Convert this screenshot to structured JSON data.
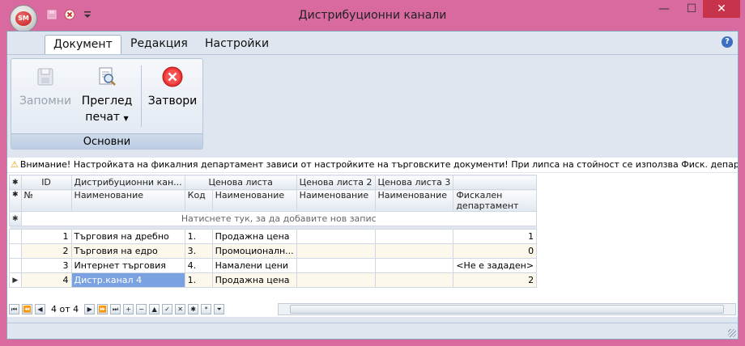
{
  "window": {
    "title": "Дистрибуционни канали",
    "app_badge": "SM",
    "minimize_glyph": "—",
    "maximize_glyph": "☐",
    "close_glyph": "✕"
  },
  "ribbon_tabs": [
    {
      "label": "Документ",
      "active": true
    },
    {
      "label": "Редакция",
      "active": false
    },
    {
      "label": "Настройки",
      "active": false
    }
  ],
  "ribbon": {
    "group_label": "Основни",
    "save_label": "Запомни",
    "preview_label_line1": "Преглед",
    "preview_label_line2": "печат",
    "close_label": "Затвори"
  },
  "warning_text": "Внимание! Настройката на фикалния департамент зависи от настройките на търговските документи! При липса на стойност се използва Фиск. департамент от позициите",
  "grid": {
    "band_headers": [
      "ID",
      "Дистрибуционни кан...",
      "Ценова листа",
      "Ценова листа 2",
      "Ценова листа 3",
      ""
    ],
    "column_headers": [
      "№",
      "Наименование",
      "Код",
      "Наименование",
      "Наименование",
      "Наименование",
      "Фискален департамент"
    ],
    "new_row_text": "Натиснете тук, за да добавите нов запис",
    "rows": [
      {
        "id": "1",
        "name": "Търговия на дребно",
        "code": "1.",
        "pl1": "Продажна цена",
        "pl2": "",
        "pl3": "",
        "fiscal": "1"
      },
      {
        "id": "2",
        "name": "Търговия на едро",
        "code": "3.",
        "pl1": "Промоционалн...",
        "pl2": "",
        "pl3": "",
        "fiscal": "0"
      },
      {
        "id": "3",
        "name": "Интернет търговия",
        "code": "4.",
        "pl1": "Намалени цени",
        "pl2": "",
        "pl3": "",
        "fiscal": "<Не е зададен>"
      },
      {
        "id": "4",
        "name": "Дистр.канал 4",
        "code": "1.",
        "pl1": "Продажна цена",
        "pl2": "",
        "pl3": "",
        "fiscal": "2"
      }
    ]
  },
  "navigator": {
    "page_text": "4 от 4"
  },
  "colors": {
    "window_frame": "#d86a9f",
    "client_bg": "#dfe6ef",
    "selection": "#7ba2e0"
  }
}
